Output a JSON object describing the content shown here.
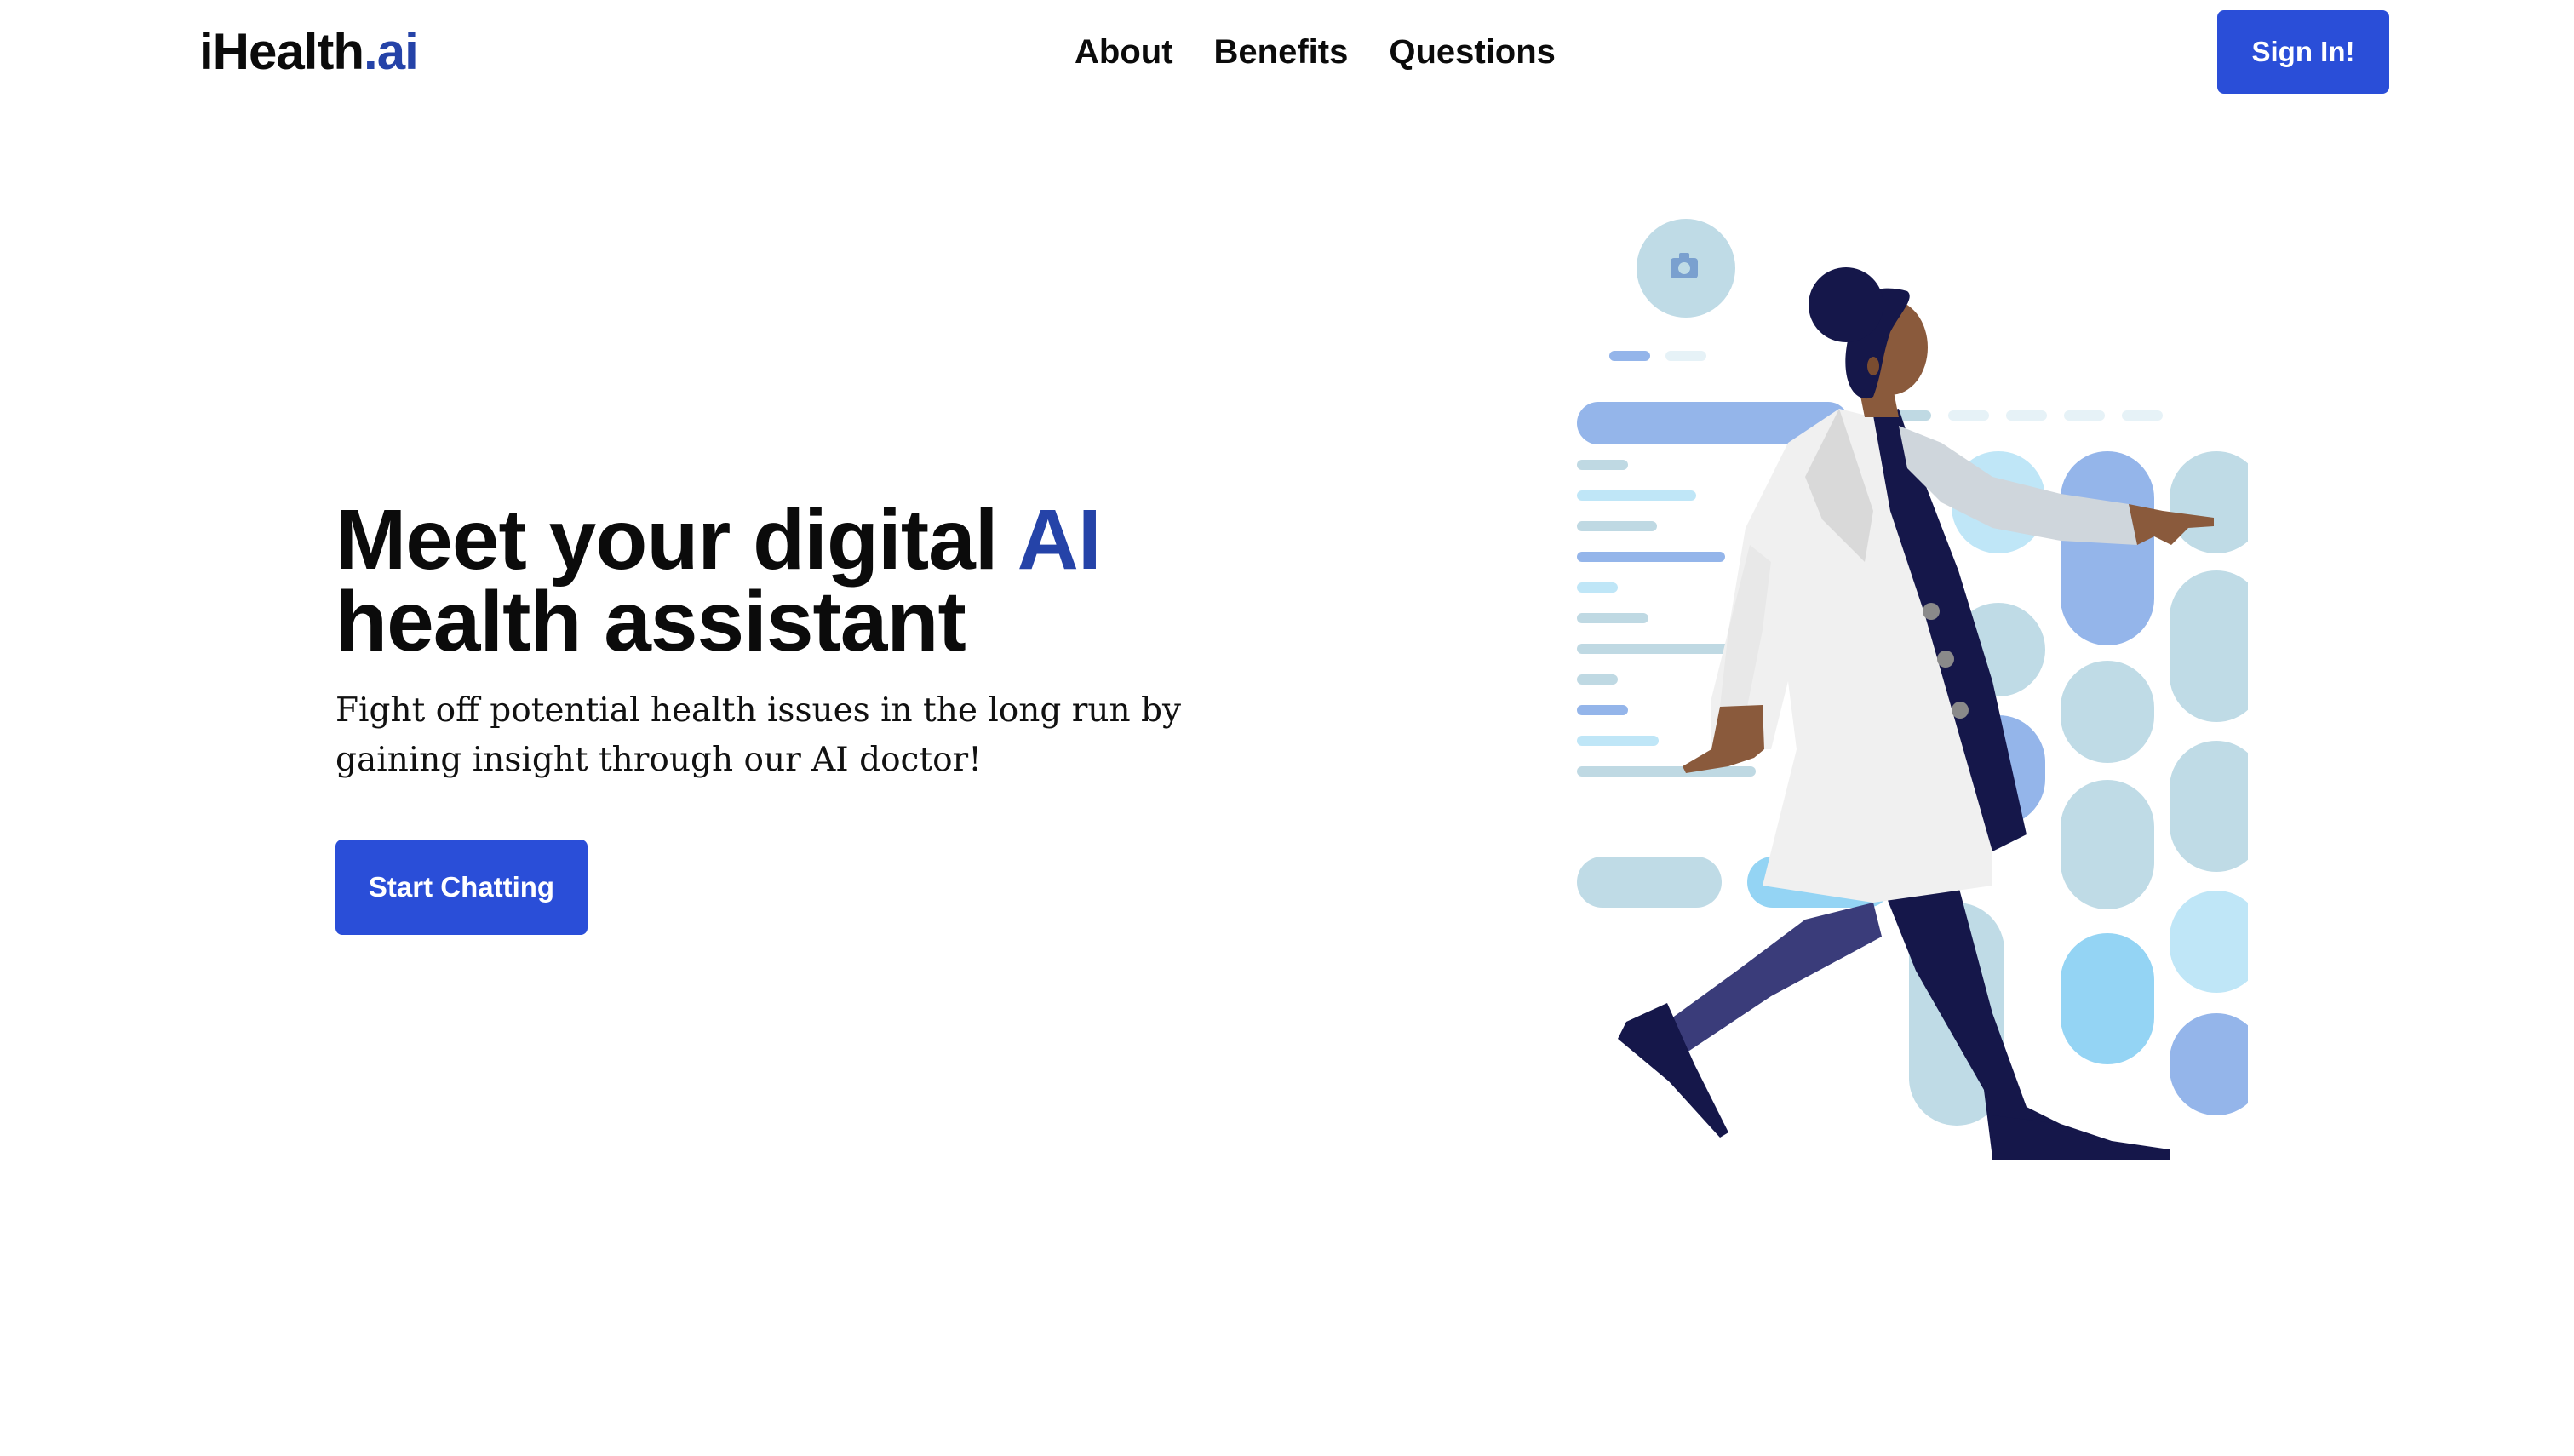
{
  "brand": {
    "name": "iHealth",
    "suffix": ".ai"
  },
  "nav": {
    "items": [
      {
        "label": "About"
      },
      {
        "label": "Benefits"
      },
      {
        "label": "Questions"
      }
    ],
    "signin_label": "Sign In!"
  },
  "hero": {
    "title_part1": "Meet your digital ",
    "title_accent": "AI",
    "title_part2": "health assistant",
    "subtitle": "Fight off potential health issues in the long run by gaining insight through our AI doctor!",
    "cta_label": "Start Chatting"
  },
  "illustration": {
    "icon": "doctor-illustration",
    "camera_icon": "camera-icon"
  },
  "colors": {
    "accent": "#2543a8",
    "button": "#2a4ed8",
    "text": "#0b0b0b",
    "navy": "#1a1a4e",
    "skin": "#8a5a3c",
    "light_blue": "#bfe6f7",
    "mid_blue": "#94b5ea",
    "grey_blue": "#bfd9e3",
    "coat": "#f0f0f0"
  }
}
